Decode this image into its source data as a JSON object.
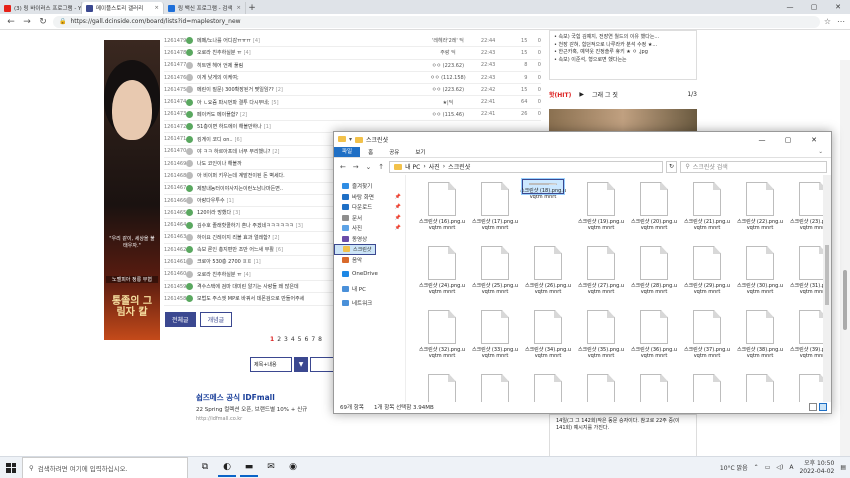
{
  "browser": {
    "tabs": [
      {
        "title": "(3) 링 바이러스 프로그램 - YouT",
        "color": "#e62117",
        "active": false
      },
      {
        "title": "메이플스토리 갤러리",
        "color": "#3b4890",
        "active": true
      },
      {
        "title": "링 백신 프로그램 - 검색",
        "color": "#1e6fd9",
        "active": false
      }
    ],
    "new_tab": "+",
    "window_controls": [
      "—",
      "▢",
      "✕"
    ],
    "url": "https://gall.dcinside.com/board/lists?id=maplestory_new",
    "url_lock": "🔒",
    "nav": [
      "←",
      "→",
      "↻"
    ],
    "right_icons": [
      "☆",
      "⋯"
    ]
  },
  "banner": {
    "quote": "\"우리 같이, 세상을 불태우자.\"",
    "caption": "노벨피아 정룡 무협",
    "logo": "통졸의 그림자 칼"
  },
  "posts": [
    {
      "num": "1261479",
      "title": "메페/노나를 어디감ㅠㅠㅠ",
      "comments": "[4]",
      "author": "'레헤라'2레' 딕",
      "time": "22:44",
      "views": "15",
      "recs": "0",
      "icon": "green"
    },
    {
      "num": "1261478",
      "title": "오로라 친추하실분 ㅠ",
      "comments": "[4]",
      "author": "주랑 딕",
      "time": "22:43",
      "views": "15",
      "recs": "0",
      "icon": "green"
    },
    {
      "num": "1261477",
      "title": "히트맨 헤어 언제 풀림",
      "comments": "",
      "author": "ㅇㅇ (223.62)",
      "time": "22:43",
      "views": "8",
      "recs": "0",
      "icon": "gray"
    },
    {
      "num": "1261476",
      "title": "이게 낮게의 이케여;",
      "comments": "",
      "author": "ㅇㅇ (112.158)",
      "time": "22:43",
      "views": "9",
      "recs": "0",
      "icon": "gray"
    },
    {
      "num": "1261475",
      "title": "메린이 질문) 300확장된거 몇일임??",
      "comments": "[2]",
      "author": "ㅇㅇ (223.62)",
      "time": "22:42",
      "views": "15",
      "recs": "0",
      "icon": "gray"
    },
    {
      "num": "1261474",
      "title": "아 ㄴ요즘 파시먼파 결투 다시부네;",
      "comments": "[5]",
      "author": "★|딕",
      "time": "22:41",
      "views": "64",
      "recs": "0",
      "icon": "green"
    },
    {
      "num": "1261473",
      "title": "페이커도 메이플함?",
      "comments": "[2]",
      "author": "ㅇㅇ (115.46)",
      "time": "22:41",
      "views": "26",
      "recs": "0",
      "icon": "green"
    },
    {
      "num": "1261472",
      "title": "51층이면 하드에이 해볼만하나",
      "comments": "[1]",
      "author": "",
      "time": "",
      "views": "",
      "recs": "",
      "icon": "green"
    },
    {
      "num": "1261471",
      "title": "킹게이 코디 on..",
      "comments": "[6]",
      "author": "",
      "time": "",
      "views": "",
      "recs": "",
      "icon": "green"
    },
    {
      "num": "1261470",
      "title": "야 ㅋㅋ 하르아프데 너무 무리했니?",
      "comments": "[2]",
      "author": "",
      "time": "",
      "views": "",
      "recs": "",
      "icon": "gray"
    },
    {
      "num": "1261469",
      "title": "나도 코인이나 해볼까",
      "comments": "",
      "author": "",
      "time": "",
      "views": "",
      "recs": "",
      "icon": "gray"
    },
    {
      "num": "1261468",
      "title": "아 비이퍼 키우는데 계발전이된 돈 벽세다.",
      "comments": "",
      "author": "",
      "time": "",
      "views": "",
      "recs": "",
      "icon": "gray"
    },
    {
      "num": "1261467",
      "title": "제발내농터이야사지는이런노남나마든면..",
      "comments": "",
      "author": "",
      "time": "",
      "views": "",
      "recs": "",
      "icon": "green"
    },
    {
      "num": "1261466",
      "title": "아랑다우투수",
      "comments": "[1]",
      "author": "",
      "time": "",
      "views": "",
      "recs": "",
      "icon": "gray"
    },
    {
      "num": "1261465",
      "title": "120이라 망했다",
      "comments": "[3]",
      "author": "",
      "time": "",
      "views": "",
      "recs": "",
      "icon": "green"
    },
    {
      "num": "1261464",
      "title": "김수호 졸래핫콜하기 혼나 주겠네ㅋㅋㅋㅋㅋㅋ",
      "comments": "[3]",
      "author": "",
      "time": "",
      "views": "",
      "recs": "",
      "icon": "green"
    },
    {
      "num": "1261463",
      "title": "하이요 긴레이지 리볼 효과 얼레함?",
      "comments": "[2]",
      "author": "",
      "time": "",
      "views": "",
      "recs": "",
      "icon": "gray"
    },
    {
      "num": "1261462",
      "title": "속보 론인 총지편만 조만 어느새 부활",
      "comments": "[6]",
      "author": "",
      "time": "",
      "views": "",
      "recs": "",
      "icon": "green"
    },
    {
      "num": "1261461",
      "title": "크로아 530층 2700 ㅍㅍ",
      "comments": "[1]",
      "author": "",
      "time": "",
      "views": "",
      "recs": "",
      "icon": "gray"
    },
    {
      "num": "1261460",
      "title": "오로라 친추하실분 ㅠ",
      "comments": "[4]",
      "author": "",
      "time": "",
      "views": "",
      "recs": "",
      "icon": "gray"
    },
    {
      "num": "1261459",
      "title": "격수스택에 검마 대미린 알기는 사랑들 왜 많은데",
      "comments": "",
      "author": "",
      "time": "",
      "views": "",
      "recs": "",
      "icon": "green"
    },
    {
      "num": "1261458",
      "title": "모법도 주스엣 MP로 바꿔서 데몬검으로 만들어주세",
      "comments": "",
      "author": "",
      "time": "",
      "views": "",
      "recs": "",
      "icon": "green"
    }
  ],
  "list_buttons": {
    "all": "전체글",
    "concept": "개념글"
  },
  "pagination": {
    "pages": [
      "1",
      "2",
      "3",
      "4",
      "5",
      "6",
      "7",
      "8"
    ],
    "current": "1"
  },
  "search": {
    "select_label": "제목+내용",
    "select_btn": "▼"
  },
  "ad": {
    "title": "쉽즈메스 공식 IDFmall",
    "desc": "22 Spring 컬렉션 오픈, 브랜드별 10% + 신규",
    "url": "http://idfmall.co.kr"
  },
  "sidebar": {
    "news": [
      "• 속보) 국힘 김예지, 전장연 월드의 이유 했다는...",
      "• 천장 갇혀, 힘던적으로 나루라카 분석 수정 ★...",
      "• 한근카혹, 예약웃 진정솔루 휴키 ★ ㅇ ,jpg",
      "• 속보) 이준석, 형으로면 했다는는"
    ],
    "tabs": {
      "hot": "핫(HIT)",
      "hot_arrow": "▶",
      "picture": "그래 그 짓",
      "page": "1/3"
    },
    "footer": "14일(그 그 142회)작은 동문 승자이다. 참고로 22주 중(이 141회) 예시지를 가진다."
  },
  "explorer": {
    "title": "스크린샷",
    "ribbon": {
      "file": "파일",
      "home": "홈",
      "share": "공유",
      "view": "보기",
      "expand": "⌄"
    },
    "path": [
      "내 PC",
      "사진",
      "스크린샷"
    ],
    "search_placeholder": "스크린샷 검색",
    "nav_items": [
      {
        "label": "즐겨찾기",
        "pin": false,
        "color": "#2f8de4",
        "selected": false
      },
      {
        "label": "바탕 화면",
        "pin": true,
        "color": "#1f6fc5",
        "selected": false
      },
      {
        "label": "다운로드",
        "pin": true,
        "color": "#1f6fc5",
        "selected": false
      },
      {
        "label": "문서",
        "pin": true,
        "color": "#8e8e8e",
        "selected": false
      },
      {
        "label": "사진",
        "pin": true,
        "color": "#5ea3e6",
        "selected": false
      },
      {
        "label": "동영상",
        "pin": false,
        "color": "#6a4ca8",
        "selected": false
      },
      {
        "label": "스크린샷",
        "pin": false,
        "color": "#f2c14a",
        "selected": true
      },
      {
        "label": "음악",
        "pin": false,
        "color": "#d96a2b",
        "selected": false
      },
      {
        "label": "OneDrive",
        "pin": false,
        "color": "#1e88e5",
        "selected": false
      },
      {
        "label": "내 PC",
        "pin": false,
        "color": "#4a90d9",
        "selected": false
      },
      {
        "label": "네트워크",
        "pin": false,
        "color": "#4a90d9",
        "selected": false
      }
    ],
    "files": [
      "스크린샷 (16).png.uvqtm mnrt",
      "스크린샷 (17).png.uvqtm mnrt",
      "스크린샷 (18).png.uvqtm mnrt",
      "스크린샷 (19).png.uvqtm mnrt",
      "스크린샷 (20).png.uvqtm mnrt",
      "스크린샷 (21).png.uvqtm mnrt",
      "스크린샷 (22).png.uvqtm mnrt",
      "스크린샷 (23).png.uvqtm mnrt",
      "스크린샷 (24).png.uvqtm mnrt",
      "스크린샷 (25).png.uvqtm mnrt",
      "스크린샷 (26).png.uvqtm mnrt",
      "스크린샷 (27).png.uvqtm mnrt",
      "스크린샷 (28).png.uvqtm mnrt",
      "스크린샷 (29).png.uvqtm mnrt",
      "스크린샷 (30).png.uvqtm mnrt",
      "스크린샷 (31).png.uvqtm mnrt",
      "스크린샷 (32).png.uvqtm mnrt",
      "스크린샷 (33).png.uvqtm mnrt",
      "스크린샷 (34).png.uvqtm mnrt",
      "스크린샷 (35).png.uvqtm mnrt",
      "스크린샷 (36).png.uvqtm mnrt",
      "스크린샷 (37).png.uvqtm mnrt",
      "스크린샷 (38).png.uvqtm mnrt",
      "스크린샷 (39).png.uvqtm mnrt",
      "",
      "",
      "",
      "",
      "",
      "",
      "",
      ""
    ],
    "selected_index": 2,
    "status": {
      "count": "69개 항목",
      "selection": "1개 항목 선택함 3.94MB"
    }
  },
  "taskbar": {
    "search_placeholder": "검색하려면 여기에 입력하십시오.",
    "icons": [
      {
        "name": "task-view-icon",
        "glyph": "⧉",
        "running": false
      },
      {
        "name": "edge-icon",
        "glyph": "◐",
        "running": true
      },
      {
        "name": "file-explorer-icon",
        "glyph": "▬",
        "running": true
      },
      {
        "name": "mail-icon",
        "glyph": "✉",
        "running": false
      },
      {
        "name": "discord-icon",
        "glyph": "◉",
        "running": false
      }
    ],
    "weather": "10°C 맑음",
    "time": "오후 10:50",
    "date": "2022-04-02"
  }
}
